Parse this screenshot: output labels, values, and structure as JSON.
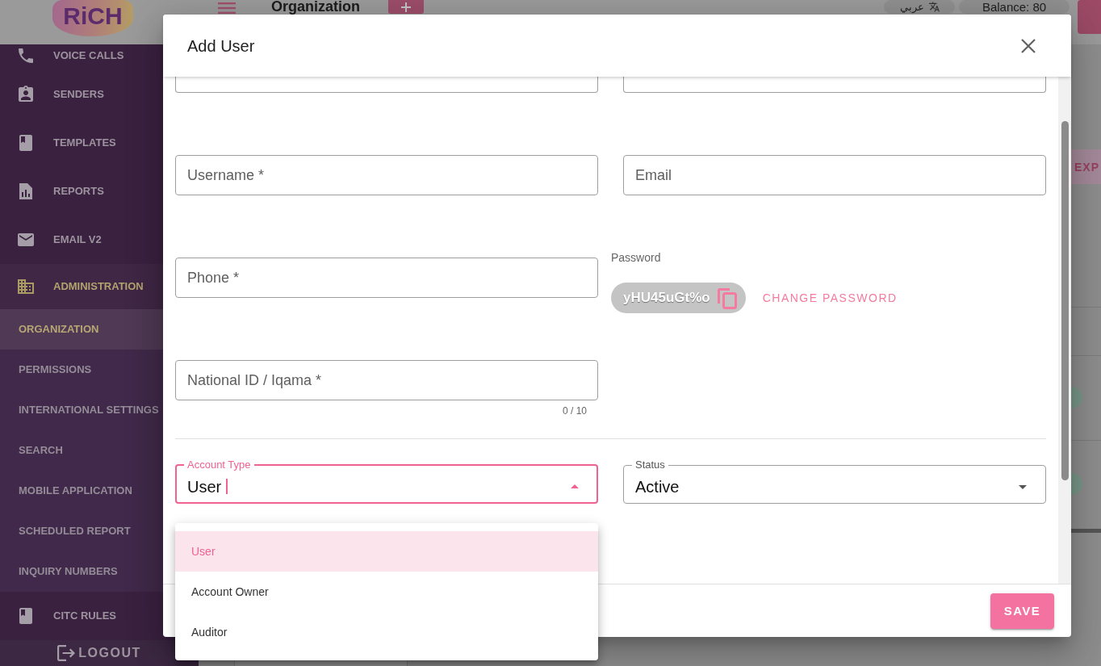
{
  "header": {
    "logo": "RiCH",
    "title": "Organization",
    "language": "عربي",
    "balance": "Balance: 80"
  },
  "sidebar": {
    "items": [
      {
        "label": "VOICE CALLS",
        "selected": false
      },
      {
        "label": "SENDERS",
        "selected": false
      },
      {
        "label": "TEMPLATES",
        "selected": false
      },
      {
        "label": "REPORTS",
        "selected": false
      },
      {
        "label": "EMAIL V2",
        "selected": false
      },
      {
        "label": "ADMINISTRATION",
        "selected": true,
        "expanded": true,
        "children": [
          {
            "label": "ORGANIZATION",
            "selected": true
          },
          {
            "label": "PERMISSIONS",
            "selected": false
          },
          {
            "label": "INTERNATIONAL SETTINGS",
            "selected": false
          },
          {
            "label": "SEARCH",
            "selected": false
          },
          {
            "label": "MOBILE APPLICATION",
            "selected": false
          },
          {
            "label": "SCHEDULED REPORT",
            "selected": false
          },
          {
            "label": "INQUIRY NUMBERS",
            "selected": false
          }
        ]
      },
      {
        "label": "CITC RULES",
        "selected": false
      }
    ],
    "logout": "LOGOUT"
  },
  "page": {
    "toolbar_button": "EXP"
  },
  "dialog": {
    "title": "Add User",
    "sections": [
      {
        "rows": [
          [
            {
              "kind": "text",
              "clipped": true
            },
            {
              "kind": "text",
              "clipped": true
            }
          ],
          [
            {
              "kind": "text",
              "placeholder": "Username *",
              "clipped": false
            },
            {
              "kind": "text",
              "placeholder": "Email",
              "clipped": false
            }
          ],
          [
            {
              "kind": "text",
              "placeholder": "Phone *",
              "clipped": false
            },
            {
              "kind": "password",
              "label": "Password",
              "value": "yHU45uGt%o",
              "action": "CHANGE PASSWORD"
            }
          ],
          [
            {
              "kind": "text",
              "placeholder": "National ID / Iqama *",
              "counter": "0 / 10",
              "clipped": false
            }
          ]
        ]
      },
      {
        "rows": [
          [
            {
              "kind": "select",
              "label": "Account Type",
              "value": "User",
              "focused": true,
              "expanded": true,
              "options": [
                {
                  "label": "User",
                  "selected": true
                },
                {
                  "label": "Account Owner",
                  "selected": false
                },
                {
                  "label": "Auditor",
                  "selected": false
                }
              ]
            },
            {
              "kind": "select",
              "label": "Status",
              "value": "Active",
              "focused": false,
              "expanded": false
            }
          ]
        ]
      }
    ],
    "buttons": [
      {
        "label": "SAVE"
      }
    ]
  }
}
